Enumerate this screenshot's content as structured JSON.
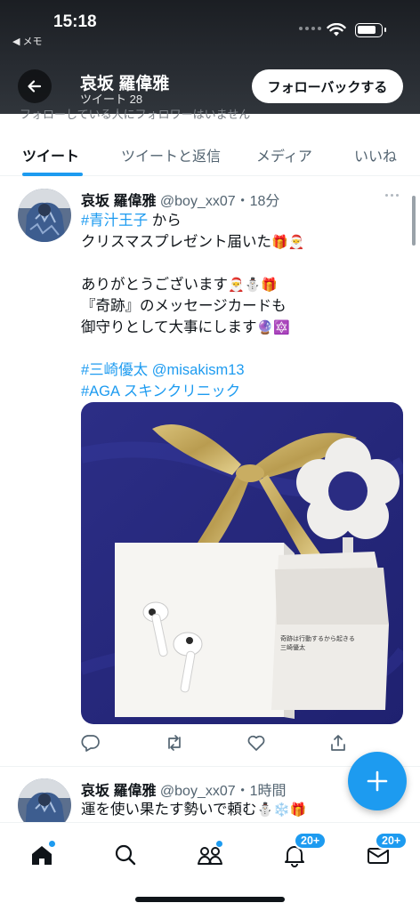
{
  "status_bar": {
    "time": "15:18",
    "back_label": "◀ メモ"
  },
  "header": {
    "name": "哀坂 羅偉雅",
    "tweet_count": "ツイート 28",
    "follow_back": "フォローバックする",
    "cut_text": "フォローしている人にフォロワーはいません"
  },
  "tabs": [
    "ツイート",
    "ツイートと返信",
    "メディア",
    "いいね"
  ],
  "tweet1": {
    "name": "哀坂 羅偉雅",
    "meta": " @boy_xx07・18分",
    "lines": [
      {
        "link": "#青汁王子",
        "text": " から"
      },
      {
        "text": "クリスマスプレゼント届いた",
        "emoji": "🎁🎅"
      },
      {
        "gap": true
      },
      {
        "text": "ありがとうございます",
        "emoji": "🎅⛄🎁"
      },
      {
        "text": "『奇跡』のメッセージカードも"
      },
      {
        "text": "御守りとして大事にします",
        "emoji": "🔮🔯"
      },
      {
        "gap": true
      },
      {
        "link": "#三崎優太 @misakism13"
      },
      {
        "link": "#AGA スキンクリニック"
      }
    ],
    "card_text_1": "奇跡は行動するから起きる",
    "card_text_2": "三崎優太"
  },
  "tweet2": {
    "name": "哀坂 羅偉雅",
    "meta": " @boy_xx07・1時間",
    "text": "運を使い果たす勢いで頼む",
    "emoji": "⛄❄️🎁"
  },
  "nav": {
    "notifications_badge": "20+",
    "messages_badge": "20+"
  },
  "colors": {
    "accent": "#1d9bf0",
    "text": "#0f1419",
    "muted": "#536471"
  },
  "icons": [
    "back-arrow-icon",
    "wifi-icon",
    "battery-icon",
    "more-icon",
    "reply-icon",
    "retweet-icon",
    "like-icon",
    "share-icon",
    "compose-plus-icon",
    "home-icon",
    "search-icon",
    "communities-icon",
    "notifications-icon",
    "messages-icon"
  ]
}
